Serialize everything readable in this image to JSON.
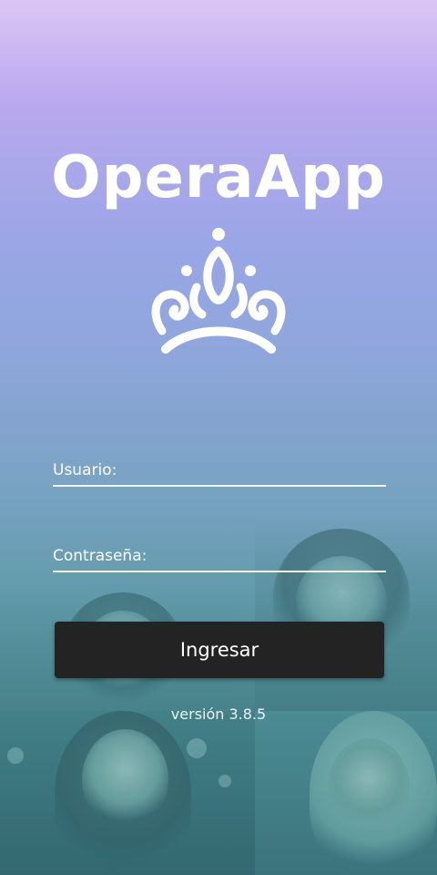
{
  "app": {
    "title": "OperaApp",
    "logo_icon": "crown-icon"
  },
  "form": {
    "username_label": "Usuario:",
    "password_label": "Contraseña:",
    "submit_label": "Ingresar"
  },
  "footer": {
    "version": "versión 3.8.5"
  },
  "colors": {
    "button_bg": "#232323",
    "text": "#ffffff",
    "gradient_top": "#dcc6f5",
    "gradient_bottom": "#3f8088"
  }
}
